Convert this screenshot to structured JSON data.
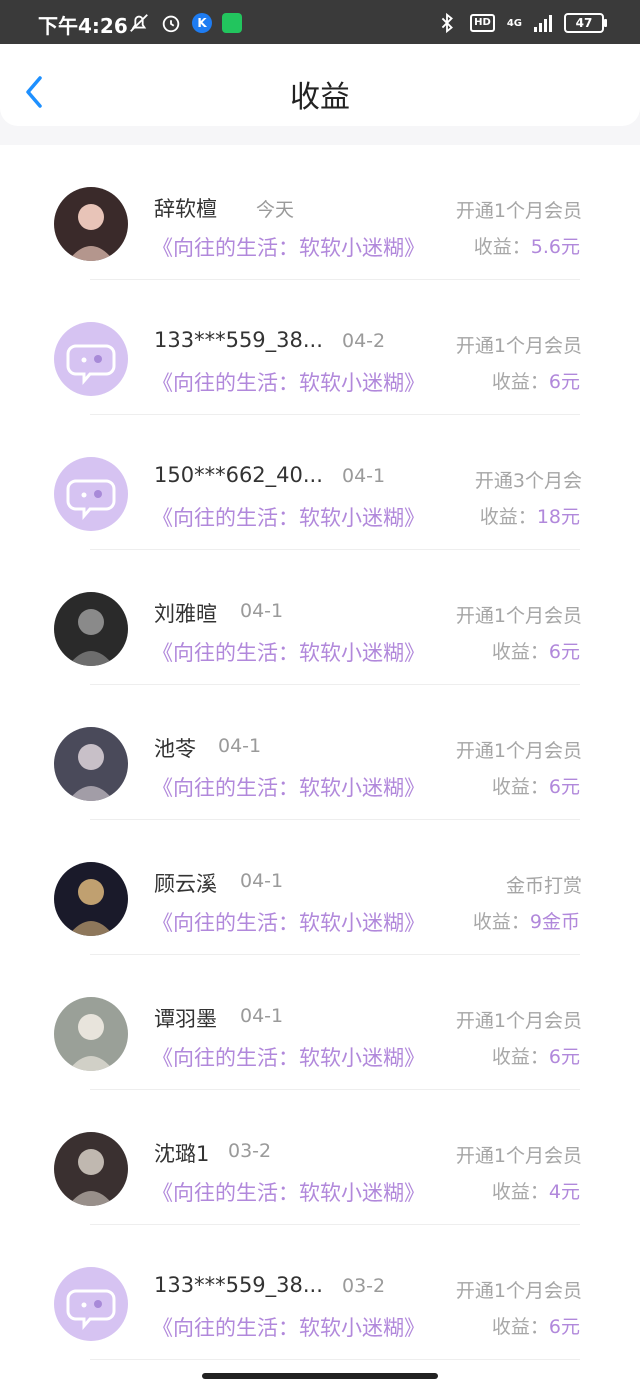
{
  "status": {
    "time": "下午4:26",
    "k_badge": "K",
    "hd": "HD",
    "network": "4G",
    "battery": "47"
  },
  "header": {
    "title": "收益"
  },
  "colors": {
    "accent": "#b188db",
    "back": "#1e90ff",
    "avatar_bg": "#d6c3f2"
  },
  "earn_label": "收益：",
  "rows": [
    {
      "name": "辞软檀",
      "date": "今天",
      "book": "《向往的生活：软软小迷糊》",
      "type": "开通1个月会员",
      "amount": "5.6元",
      "avatar": "photo"
    },
    {
      "name": "133***559_38...",
      "date": "04-2",
      "book": "《向往的生活：软软小迷糊》",
      "type": "开通1个月会员",
      "amount": "6元",
      "avatar": "default"
    },
    {
      "name": "150***662_40...",
      "date": "04-1",
      "book": "《向往的生活：软软小迷糊》",
      "type": "开通3个月会",
      "amount": "18元",
      "avatar": "default"
    },
    {
      "name": "刘雅暄",
      "date": "04-1",
      "book": "《向往的生活：软软小迷糊》",
      "type": "开通1个月会员",
      "amount": "6元",
      "avatar": "photo"
    },
    {
      "name": "池苓",
      "date": "04-1",
      "book": "《向往的生活：软软小迷糊》",
      "type": "开通1个月会员",
      "amount": "6元",
      "avatar": "photo"
    },
    {
      "name": "顾云溪",
      "date": "04-1",
      "book": "《向往的生活：软软小迷糊》",
      "type": "金币打赏",
      "amount": "9金币",
      "avatar": "photo"
    },
    {
      "name": "谭羽墨",
      "date": "04-1",
      "book": "《向往的生活：软软小迷糊》",
      "type": "开通1个月会员",
      "amount": "6元",
      "avatar": "photo"
    },
    {
      "name": "沈璐1",
      "date": "03-2",
      "book": "《向往的生活：软软小迷糊》",
      "type": "开通1个月会员",
      "amount": "4元",
      "avatar": "photo"
    },
    {
      "name": "133***559_38...",
      "date": "03-2",
      "book": "《向往的生活：软软小迷糊》",
      "type": "开通1个月会员",
      "amount": "6元",
      "avatar": "default"
    }
  ]
}
